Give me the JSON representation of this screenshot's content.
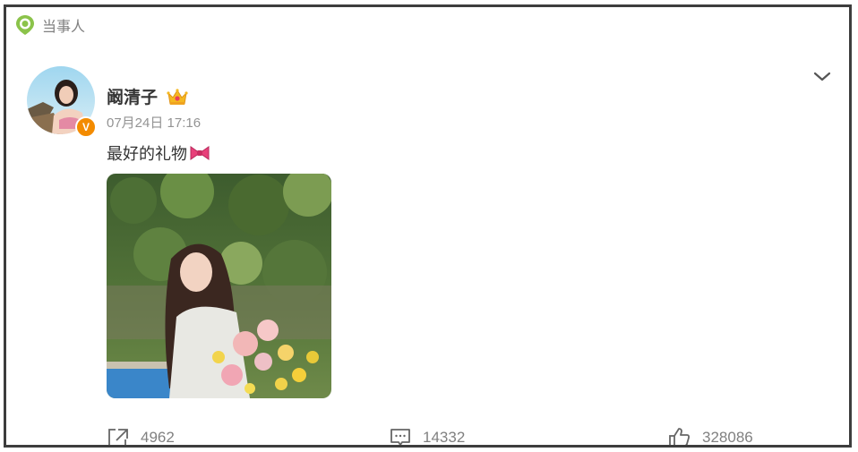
{
  "header": {
    "tag_text": "当事人",
    "tag_icon": "location-pin-icon",
    "accent_color": "#8bc34a"
  },
  "post": {
    "author": {
      "name": "阚清子",
      "verified_badge": "V",
      "badge_color": "#f38b00",
      "crown_icon": "crown-icon"
    },
    "timestamp": "07月24日 17:16",
    "text": "最好的礼物",
    "emoji": "ribbon-bow-icon"
  },
  "actions": {
    "repost_count": "4962",
    "comment_count": "14332",
    "like_count": "328086"
  }
}
